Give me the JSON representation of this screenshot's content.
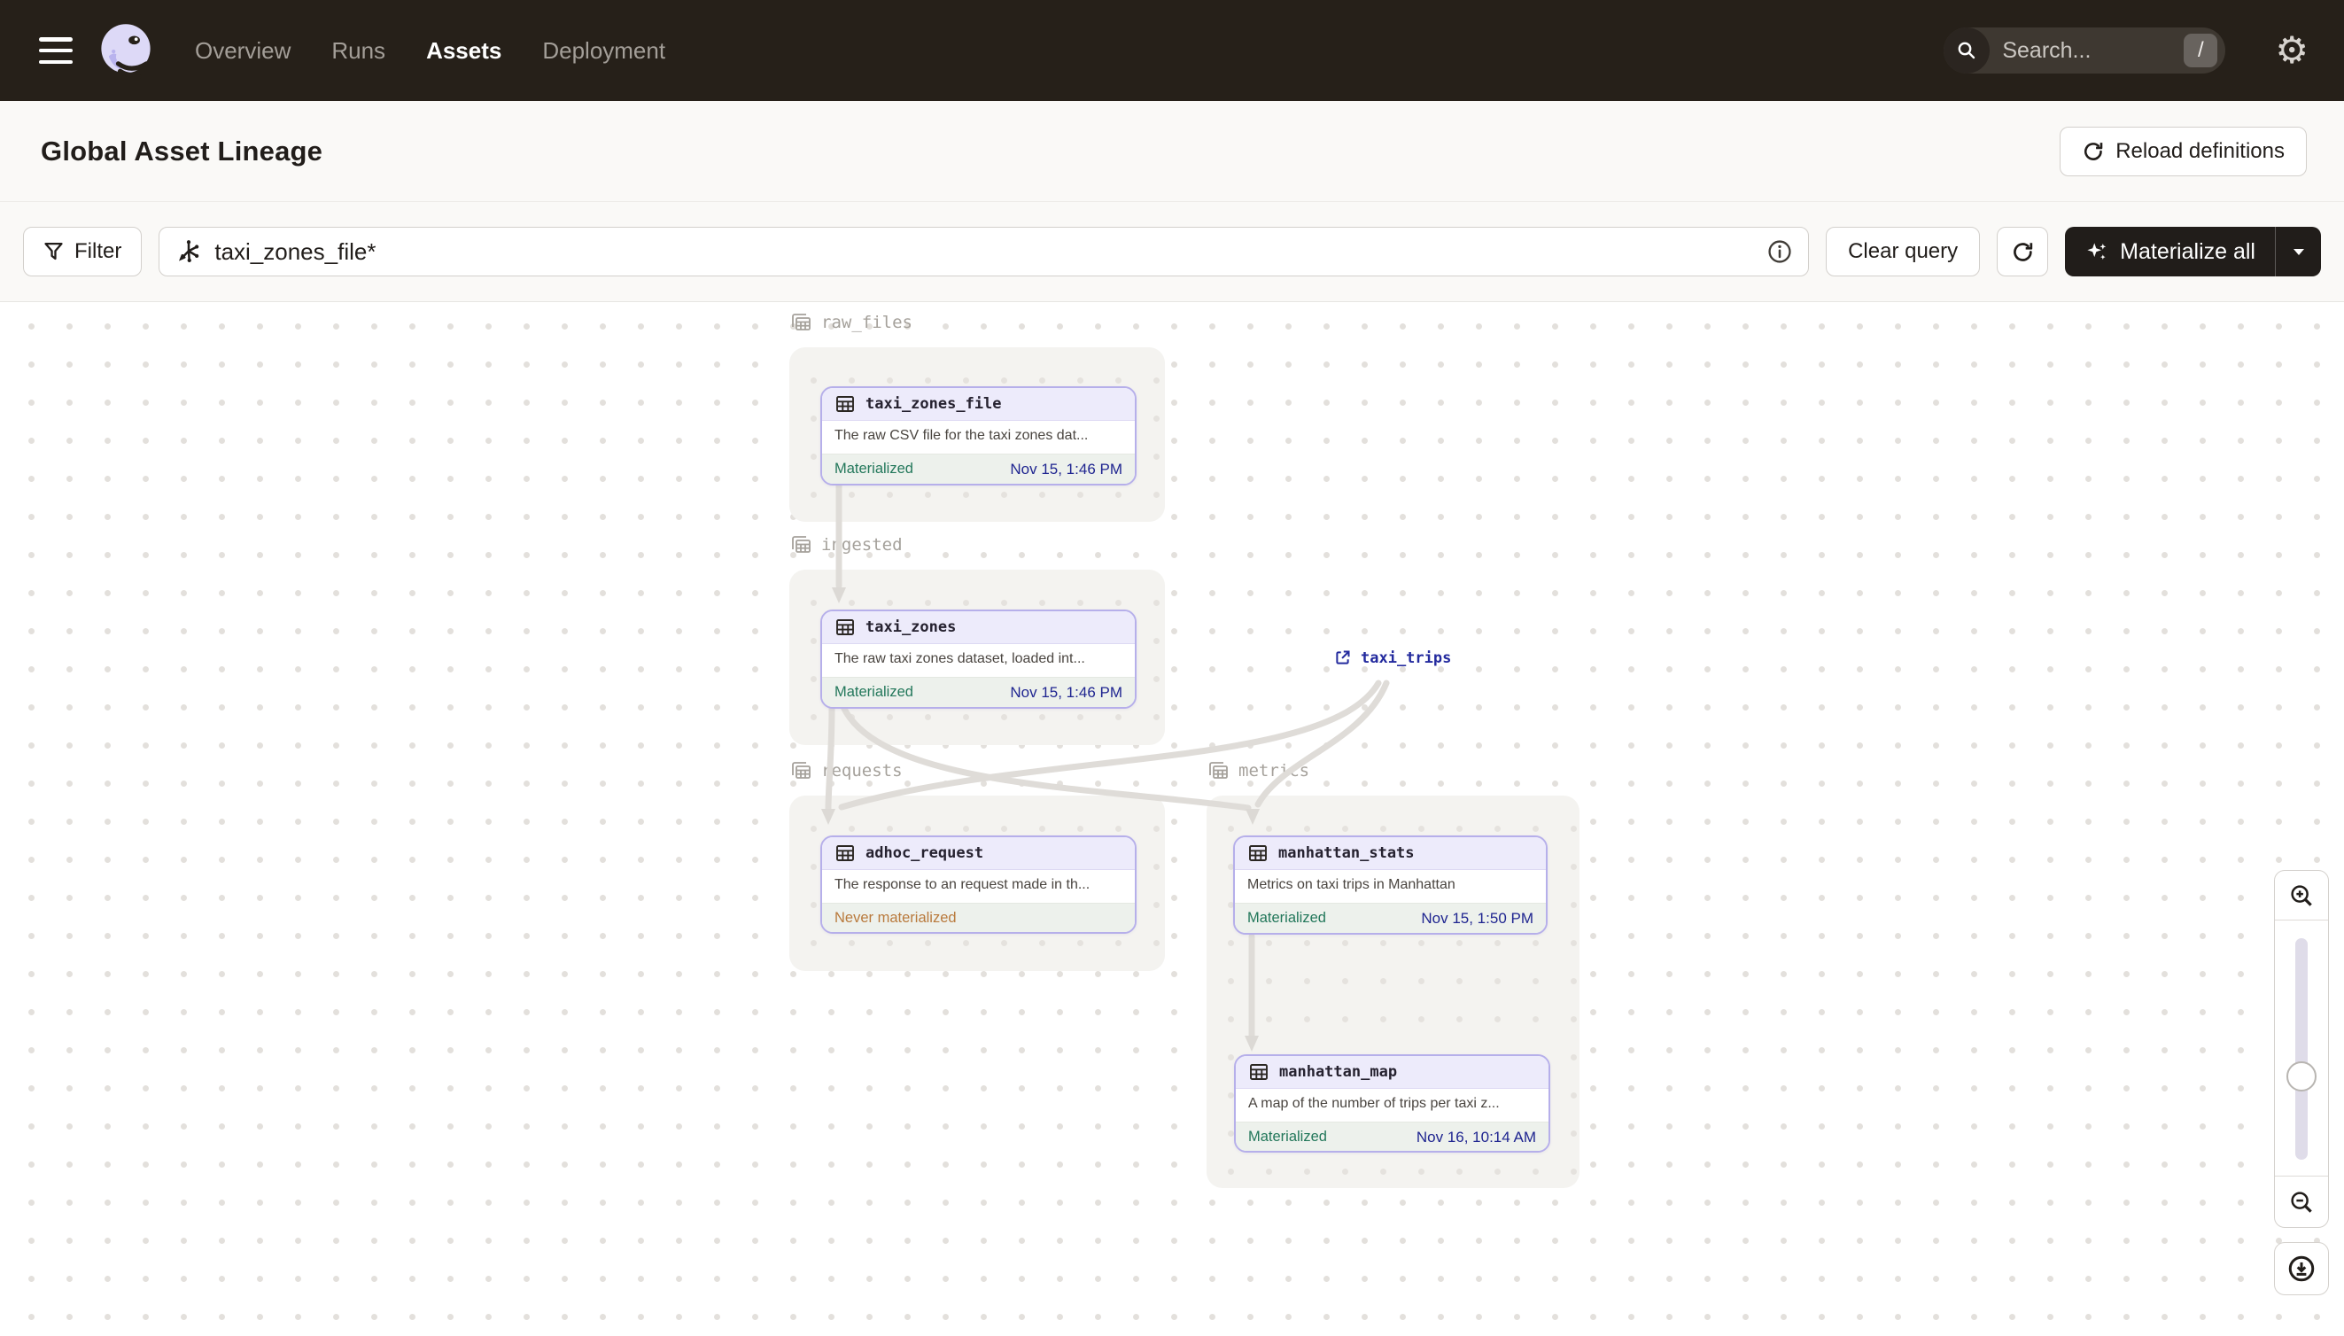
{
  "nav": {
    "items": [
      {
        "label": "Overview",
        "active": false
      },
      {
        "label": "Runs",
        "active": false
      },
      {
        "label": "Assets",
        "active": true
      },
      {
        "label": "Deployment",
        "active": false
      }
    ],
    "search_placeholder": "Search...",
    "search_shortcut": "/"
  },
  "header": {
    "title": "Global Asset Lineage",
    "reload_label": "Reload definitions"
  },
  "toolbar": {
    "filter_label": "Filter",
    "query_value": "taxi_zones_file*",
    "clear_label": "Clear query",
    "materialize_label": "Materialize all"
  },
  "graph": {
    "groups": [
      {
        "label": "raw_files"
      },
      {
        "label": "ingested"
      },
      {
        "label": "requests"
      },
      {
        "label": "metrics"
      }
    ],
    "nodes": [
      {
        "title": "taxi_zones_file",
        "description": "The raw CSV file for the taxi zones dat...",
        "status": "Materialized",
        "timestamp": "Nov 15, 1:46 PM"
      },
      {
        "title": "taxi_zones",
        "description": "The raw taxi zones dataset, loaded int...",
        "status": "Materialized",
        "timestamp": "Nov 15, 1:46 PM"
      },
      {
        "title": "adhoc_request",
        "description": "The response to an request made in th...",
        "status": "Never materialized",
        "timestamp": ""
      },
      {
        "title": "manhattan_stats",
        "description": "Metrics on taxi trips in Manhattan",
        "status": "Materialized",
        "timestamp": "Nov 15, 1:50 PM"
      },
      {
        "title": "manhattan_map",
        "description": "A map of the number of trips per taxi z...",
        "status": "Materialized",
        "timestamp": "Nov 16, 10:14 AM"
      }
    ],
    "external": [
      {
        "label": "taxi_trips"
      }
    ]
  },
  "colors": {
    "nav_bg": "#262019",
    "node_border": "#B6AFEA",
    "node_header_bg": "#EDEBFB",
    "materialized_green": "#22775A",
    "timestamp_navy": "#1F2590",
    "never_materialized_orange": "#B97A3D",
    "edge_gray": "#DFDCD8",
    "dark_button": "#211D1A"
  }
}
